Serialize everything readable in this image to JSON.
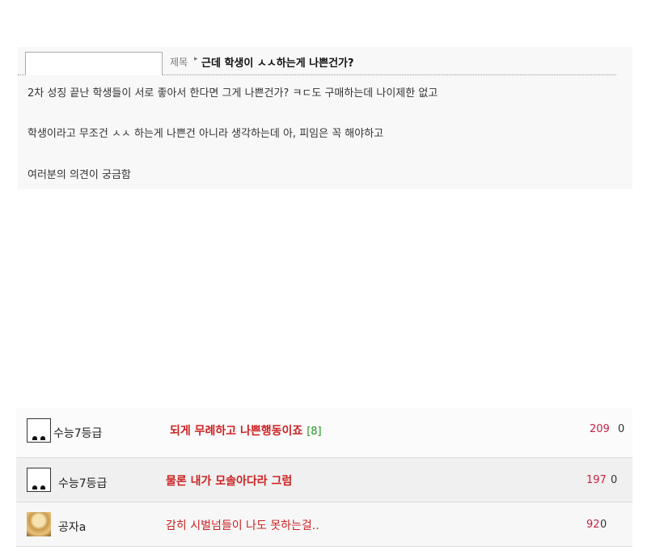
{
  "post": {
    "title_label": "제목",
    "title_arrow": "▸",
    "title": "근데 학생이 ㅅㅅ하는게 나쁜건가?",
    "lines": [
      "2차 성징 끝난 학생들이 서로 좋아서 한다면 그게 나쁜건가? ㅋㄷ도 구매하는데 나이제한 없고",
      "학생이라고 무조건 ㅅㅅ 하는게 나쁜건 아니라 생각하는데 아, 피임은 꼭 해야하고",
      "여러분의 의견이 궁금함"
    ]
  },
  "comments": [
    {
      "nick": "수능7등급",
      "avatar": "default-avatar-icon",
      "text": "되게 무례하고 나쁜행동이죠",
      "reply_count": "[8]",
      "views": "209",
      "votes": "0",
      "bold": true
    },
    {
      "nick": "수능7등급",
      "avatar": "default-avatar-icon",
      "text": "물론 내가 모솔아다라 그럼",
      "reply_count": "",
      "views": "197",
      "votes": "0",
      "bold": true
    },
    {
      "nick": "공자a",
      "avatar": "photo-avatar",
      "text": "감히 시벌넘들이 나도 못하는걸..",
      "reply_count": "",
      "views": "92",
      "votes": "0",
      "bold": false
    }
  ],
  "colors": {
    "accent_red": "#cc2222",
    "count_green": "#229922",
    "views_red": "#cc2244"
  }
}
